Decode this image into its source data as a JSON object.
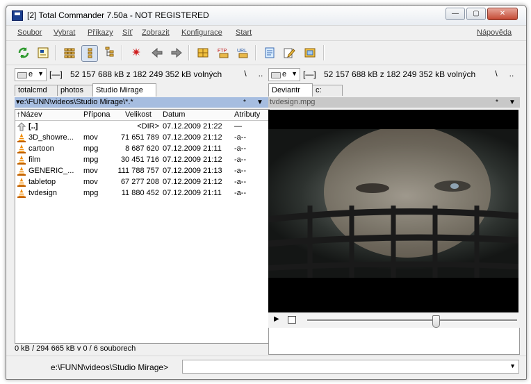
{
  "window": {
    "title": "[2] Total Commander 7.50a - NOT REGISTERED",
    "minimize": "—",
    "maximize": "▢",
    "close": "✕"
  },
  "menu": [
    "Soubor",
    "Vybrat",
    "Příkazy",
    "Síť",
    "Zobrazit",
    "Konfigurace",
    "Start",
    "Nápověda"
  ],
  "toolbar_icons": [
    "refresh-icon",
    "brief-view-icon",
    "thumbnail-view-icon",
    "tree-view-icon",
    "tree-view-alt-icon",
    "invert-selection-icon",
    "back-icon",
    "forward-icon",
    "pack-icon",
    "ftp-icon",
    "url-icon",
    "notepad-icon",
    "edit-icon",
    "sync-icon"
  ],
  "toolbar_labels": {
    "ftp": "FTP",
    "url": "URL"
  },
  "left": {
    "drive": "e",
    "drive_label": "[—]",
    "space": "52 157 688 kB z 182 249 352 kB volných",
    "root_btn": "\\",
    "up_btn": "..",
    "tabs": [
      "totalcmd",
      "photos",
      "Studio Mirage"
    ],
    "path": "▾e:\\FUNN\\videos\\Studio Mirage\\*.*",
    "path_star": "*",
    "path_arrow": "▼",
    "columns": {
      "name": "↑Název",
      "ext": "Přípona",
      "size": "Velikost",
      "date": "Datum",
      "attr": "Atributy"
    },
    "files": [
      {
        "name": "[..]",
        "ext": "",
        "size": "<DIR>",
        "date": "07.12.2009 21:22",
        "attr": "—",
        "icon": "up-folder-icon"
      },
      {
        "name": "3D_showre...",
        "ext": "mov",
        "size": "71 651 789",
        "date": "07.12.2009 21:12",
        "attr": "-a--",
        "icon": "vlc-cone-icon"
      },
      {
        "name": "cartoon",
        "ext": "mpg",
        "size": "8 687 620",
        "date": "07.12.2009 21:11",
        "attr": "-a--",
        "icon": "vlc-cone-icon"
      },
      {
        "name": "film",
        "ext": "mpg",
        "size": "30 451 716",
        "date": "07.12.2009 21:12",
        "attr": "-a--",
        "icon": "vlc-cone-icon"
      },
      {
        "name": "GENERIC_...",
        "ext": "mov",
        "size": "111 788 757",
        "date": "07.12.2009 21:13",
        "attr": "-a--",
        "icon": "vlc-cone-icon"
      },
      {
        "name": "tabletop",
        "ext": "mov",
        "size": "67 277 208",
        "date": "07.12.2009 21:12",
        "attr": "-a--",
        "icon": "vlc-cone-icon"
      },
      {
        "name": "tvdesign",
        "ext": "mpg",
        "size": "11 880 452",
        "date": "07.12.2009 21:11",
        "attr": "-a--",
        "icon": "vlc-cone-icon"
      }
    ],
    "status": "0 kB / 294 665 kB v 0 / 6 souborech"
  },
  "right": {
    "drive": "e",
    "drive_label": "[—]",
    "space": "52 157 688 kB z 182 249 352 kB volných",
    "root_btn": "\\",
    "up_btn": "..",
    "tabs": [
      "Deviantr",
      "c:"
    ],
    "path": "tvdesign.mpg",
    "path_star": "*",
    "path_arrow": "▼",
    "play": "▶",
    "playlist_icon": "playlist-icon"
  },
  "cmdline": {
    "path": "e:\\FUNN\\videos\\Studio Mirage>",
    "value": "",
    "arrow": "▼"
  },
  "colors": {
    "accent": "#a6bde0",
    "vlc_orange": "#f08a00"
  }
}
